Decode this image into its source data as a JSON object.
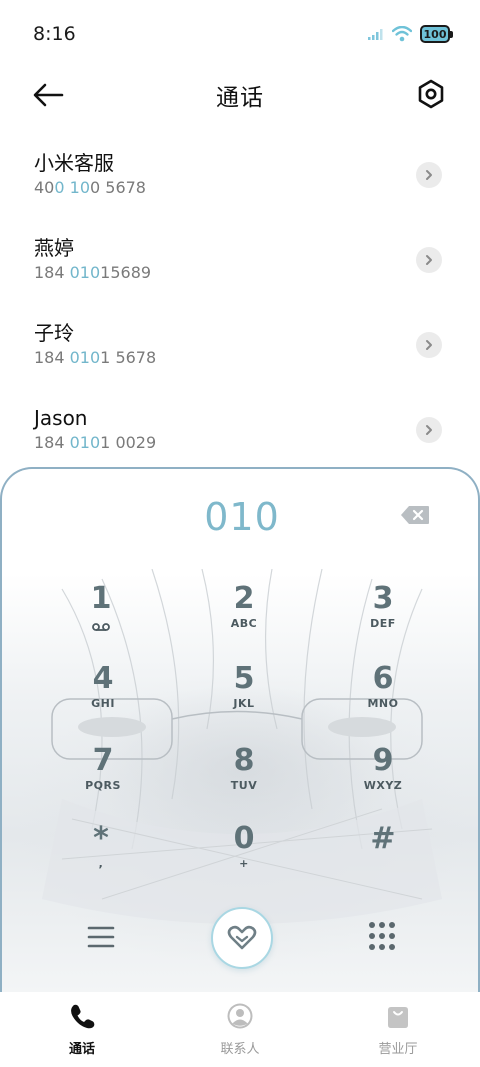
{
  "status": {
    "time": "8:16",
    "battery": "100",
    "accent": "#6fc2d8"
  },
  "header": {
    "title": "通话",
    "back_icon": "arrow-left-icon",
    "settings_icon": "settings-hexagon-icon"
  },
  "recents": [
    {
      "name": "小米客服",
      "number_parts": [
        "40",
        "0",
        " ",
        "10",
        "0 5678"
      ],
      "highlight": [
        false,
        true,
        false,
        true,
        false
      ]
    },
    {
      "name": "燕婷",
      "number_parts": [
        "184 ",
        "010",
        "15689"
      ],
      "highlight": [
        false,
        true,
        false
      ]
    },
    {
      "name": "子玲",
      "number_parts": [
        "184 ",
        "010",
        "1 5678"
      ],
      "highlight": [
        false,
        true,
        false
      ]
    },
    {
      "name": "Jason",
      "number_parts": [
        "184 ",
        "010",
        "1 0029"
      ],
      "highlight": [
        false,
        true,
        false
      ]
    }
  ],
  "dialer": {
    "display": "010",
    "keys": [
      {
        "digit": "1",
        "letters": "voicemail-icon"
      },
      {
        "digit": "2",
        "letters": "ABC"
      },
      {
        "digit": "3",
        "letters": "DEF"
      },
      {
        "digit": "4",
        "letters": "GHI"
      },
      {
        "digit": "5",
        "letters": "JKL"
      },
      {
        "digit": "6",
        "letters": "MNO"
      },
      {
        "digit": "7",
        "letters": "PQRS"
      },
      {
        "digit": "8",
        "letters": "TUV"
      },
      {
        "digit": "9",
        "letters": "WXYZ"
      },
      {
        "digit": "*",
        "letters": ","
      },
      {
        "digit": "0",
        "letters": "+"
      },
      {
        "digit": "#",
        "letters": ""
      }
    ],
    "highlight_color": "#7fb8cb"
  },
  "tabs": [
    {
      "label": "通话",
      "icon": "phone-icon",
      "active": true
    },
    {
      "label": "联系人",
      "icon": "contact-person-icon",
      "active": false
    },
    {
      "label": "营业厅",
      "icon": "shopping-bag-icon",
      "active": false
    }
  ]
}
